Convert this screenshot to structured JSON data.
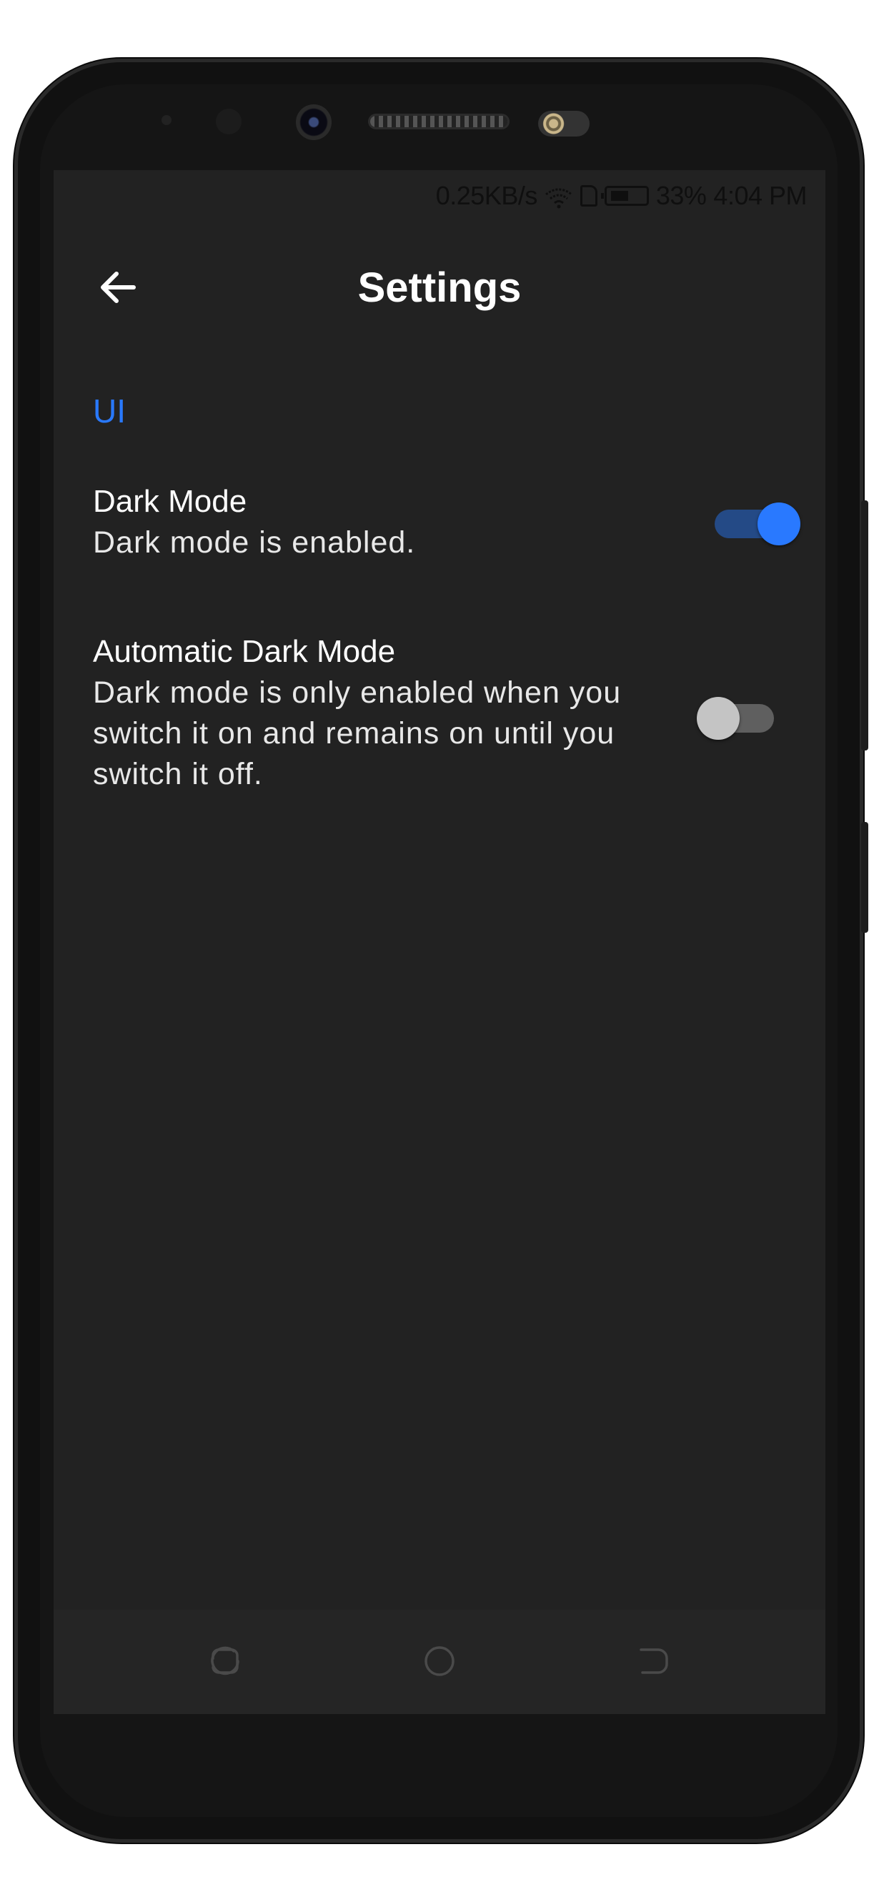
{
  "status_bar": {
    "net_speed": "0.25KB/s",
    "battery": "33%",
    "time": "4:04 PM",
    "icons": [
      "wifi-icon",
      "sim-icon",
      "battery-icon"
    ]
  },
  "app_bar": {
    "title": "Settings",
    "back_icon": "arrow-left-icon"
  },
  "section": {
    "header": "UI"
  },
  "preferences": [
    {
      "title": "Dark Mode",
      "summary": "Dark mode is enabled.",
      "enabled": true
    },
    {
      "title": "Automatic Dark Mode",
      "summary": "Dark mode is only enabled when you switch it on and remains on until you switch it off.",
      "enabled": false
    }
  ],
  "nav_bar": {
    "icons": [
      "recents-icon",
      "home-icon",
      "back-icon"
    ]
  },
  "colors": {
    "background": "#222222",
    "accent": "#2979ff",
    "text_primary": "#ffffff",
    "switch_on_track": "#244a86",
    "switch_off_thumb": "#c4c4c4",
    "switch_off_track": "#5f5f5f"
  }
}
